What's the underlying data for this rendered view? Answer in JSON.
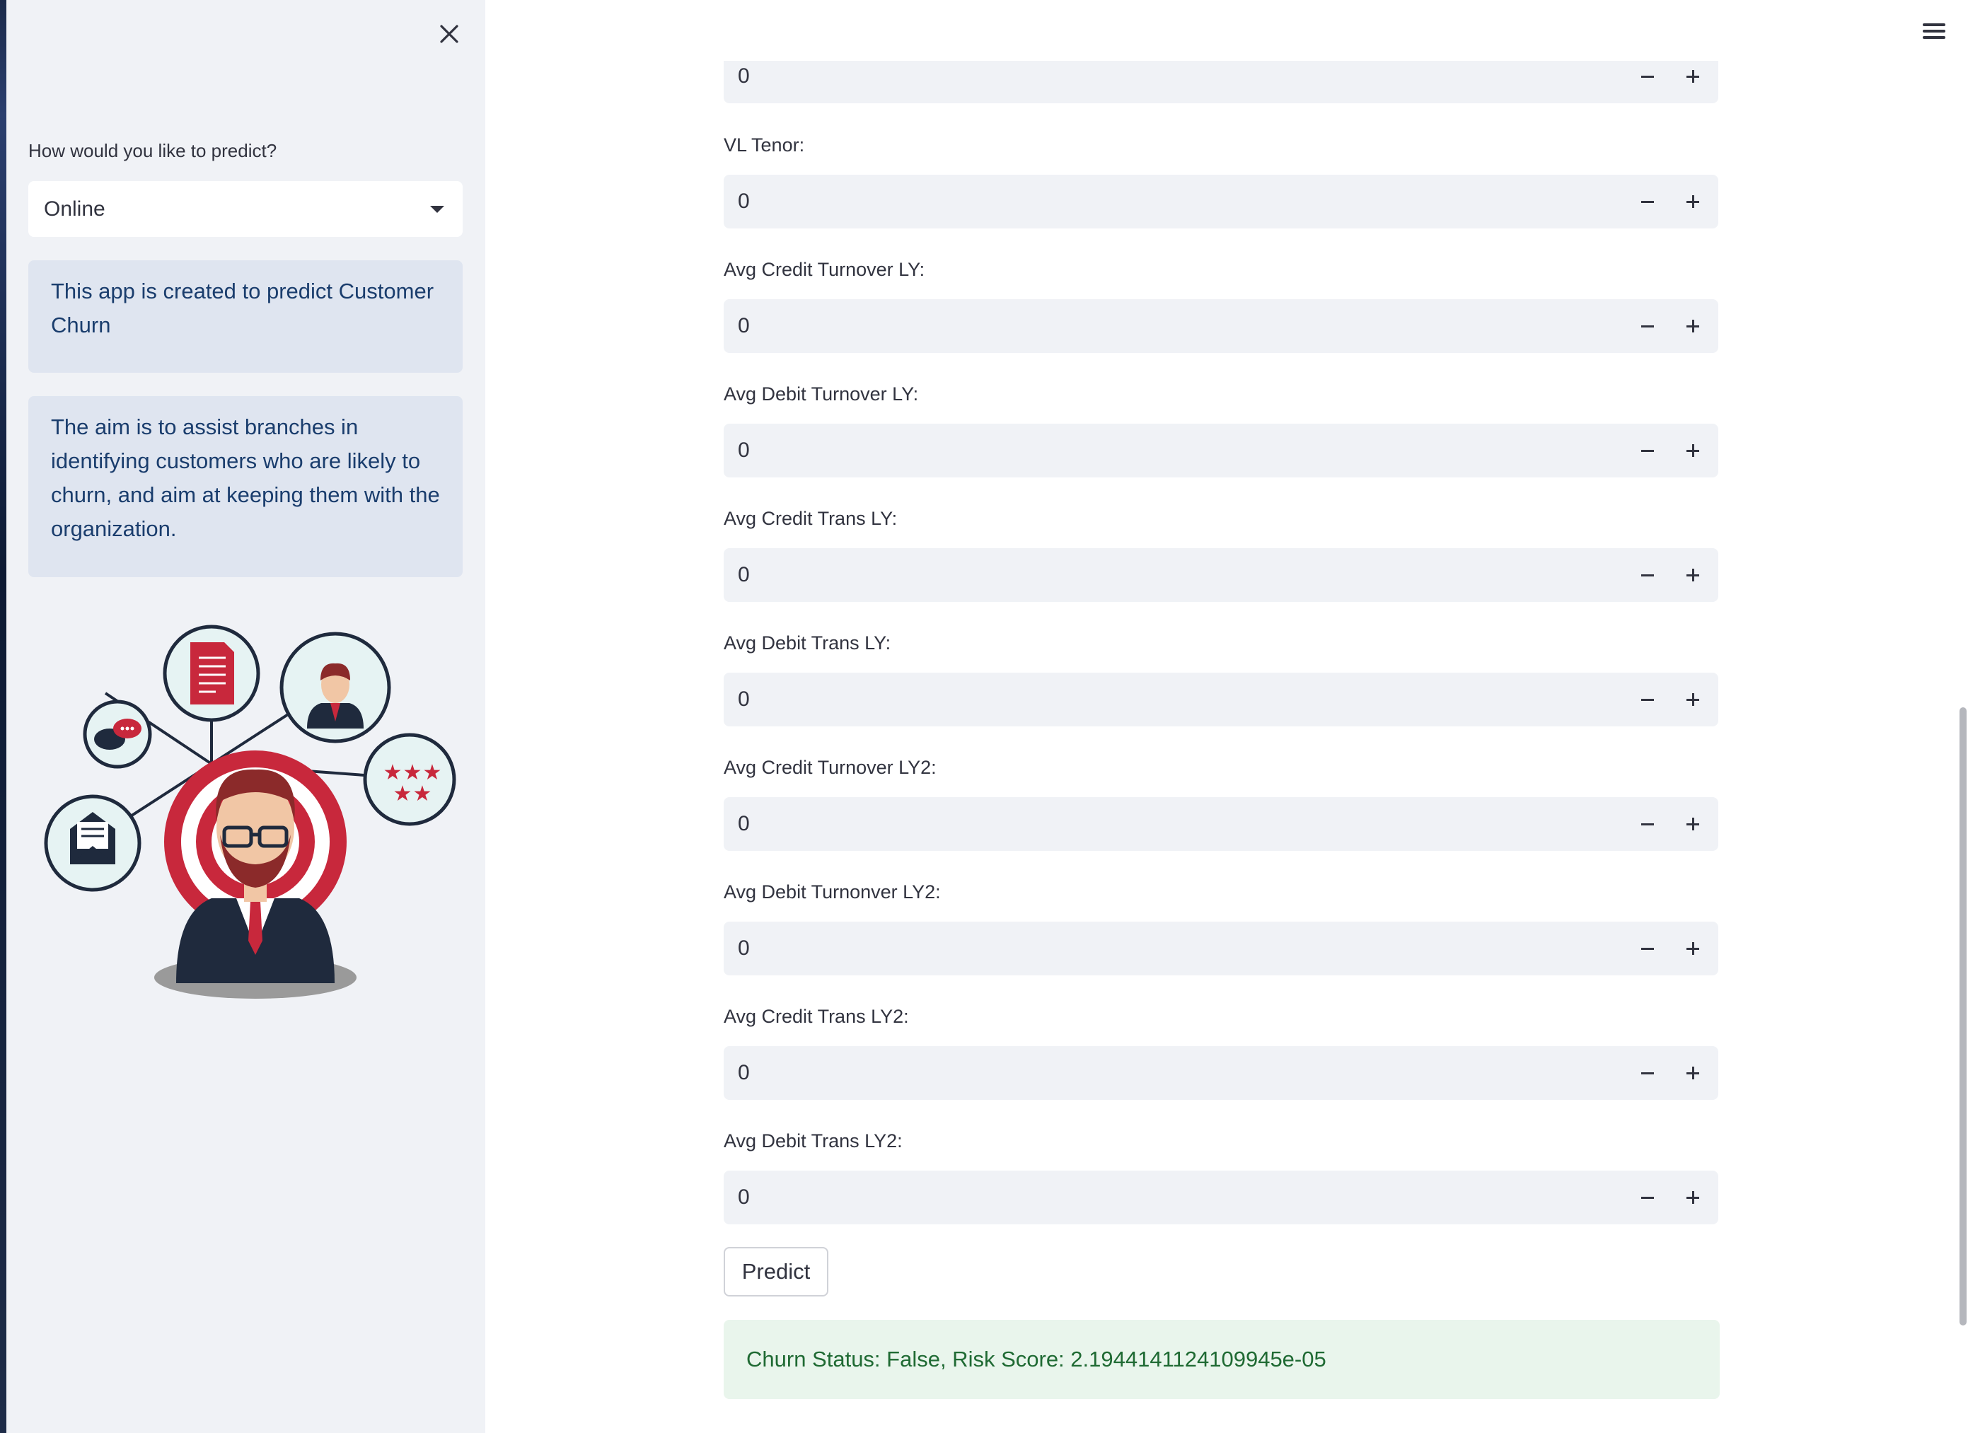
{
  "sidebar": {
    "predict_mode_label": "How would you like to predict?",
    "predict_mode_value": "Online",
    "info_1": "This app is created to predict Customer Churn",
    "info_2": "The aim is to assist branches in identifying customers who are likely to churn, and aim at keeping them with the organization."
  },
  "form": {
    "top_field_value": "0",
    "fields": [
      {
        "label": "VL Tenor:",
        "value": "0"
      },
      {
        "label": "Avg Credit Turnover LY:",
        "value": "0"
      },
      {
        "label": "Avg Debit Turnover LY:",
        "value": "0"
      },
      {
        "label": "Avg Credit Trans LY:",
        "value": "0"
      },
      {
        "label": "Avg Debit Trans LY:",
        "value": "0"
      },
      {
        "label": "Avg Credit Turnover LY2:",
        "value": "0"
      },
      {
        "label": "Avg Debit Turnonver LY2:",
        "value": "0"
      },
      {
        "label": "Avg Credit Trans LY2:",
        "value": "0"
      },
      {
        "label": "Avg Debit Trans LY2:",
        "value": "0"
      }
    ],
    "predict_label": "Predict",
    "result": "Churn Status: False, Risk Score: 2.1944141124109945e-05"
  },
  "colors": {
    "sidebar_bg": "#f0f2f6",
    "info_bg": "#dfe5f0",
    "success_bg": "#e9f5ec",
    "success_text": "#1f6a33",
    "accent_red": "#c8283c"
  }
}
